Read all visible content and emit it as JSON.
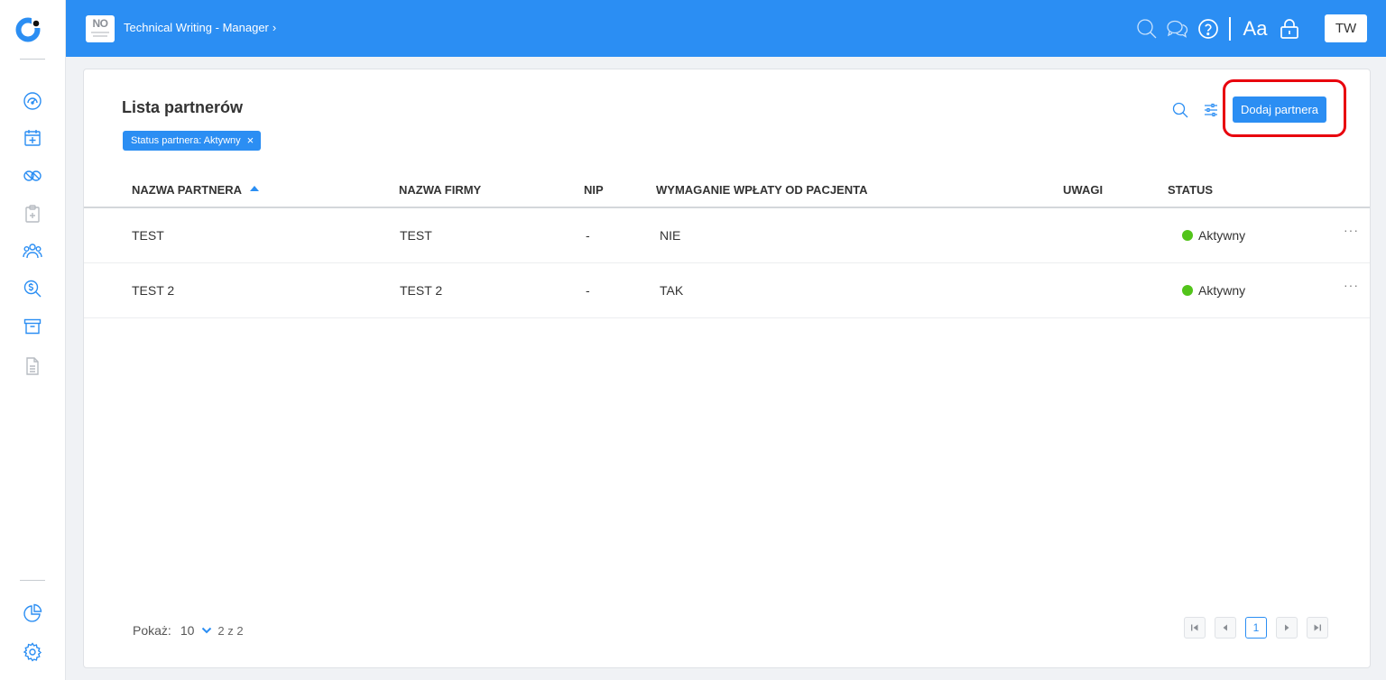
{
  "colors": {
    "accent": "#2b8ef3",
    "status_active": "#52c41a",
    "highlight": "#e8000d"
  },
  "sidebar": {
    "items": [
      {
        "name": "dashboard-gauge-icon"
      },
      {
        "name": "calendar-add-icon"
      },
      {
        "name": "pills-icon"
      },
      {
        "name": "clipboard-medical-icon"
      },
      {
        "name": "users-group-icon"
      },
      {
        "name": "search-dollar-icon"
      },
      {
        "name": "archive-icon"
      },
      {
        "name": "document-icon"
      }
    ],
    "bottom": [
      {
        "name": "pie-chart-icon"
      },
      {
        "name": "gear-icon"
      }
    ]
  },
  "topbar": {
    "org_badge": "NO",
    "breadcrumb": "Technical Writing - Manager",
    "breadcrumb_chevron": "›",
    "font_size_toggle": "Aa",
    "user_initials": "TW",
    "icons": [
      "search-icon",
      "chat-icon",
      "help-icon",
      "lock-icon"
    ]
  },
  "main": {
    "title": "Lista partnerów",
    "filter_chip": "Status partnera: Aktywny",
    "filter_chip_close": "×",
    "add_button": "Dodaj partnera",
    "table": {
      "columns": [
        "NAZWA PARTNERA",
        "NAZWA FIRMY",
        "NIP",
        "WYMAGANIE WPŁATY OD PACJENTA",
        "UWAGI",
        "STATUS"
      ],
      "sorted_column": "NAZWA PARTNERA",
      "sort_direction": "ascending",
      "rows": [
        {
          "partner": "TEST",
          "company": "TEST",
          "nip": "-",
          "payment": "NIE",
          "notes": "",
          "status": "Aktywny",
          "more": "···"
        },
        {
          "partner": "TEST 2",
          "company": "TEST 2",
          "nip": "-",
          "payment": "TAK",
          "notes": "",
          "status": "Aktywny",
          "more": "···"
        }
      ]
    },
    "footer": {
      "show_label": "Pokaż:",
      "page_size": "10",
      "count_text": "2 z 2",
      "current_page": "1"
    }
  }
}
